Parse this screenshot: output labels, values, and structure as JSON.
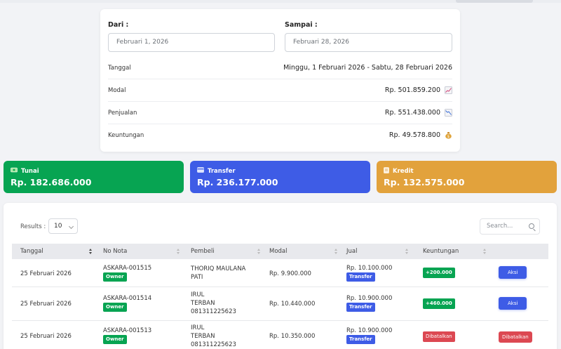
{
  "summary": {
    "from_label": "Dari :",
    "from_value": "Februari 1, 2026",
    "to_label": "Sampai :",
    "to_value": "Februari 28, 2026",
    "rows": [
      {
        "label": "Tanggal",
        "value": "Minggu, 1 Februari 2026 - Sabtu, 28 Februari 2026",
        "icon": ""
      },
      {
        "label": "Modal",
        "value": "Rp. 501.859.200",
        "icon": "chart-increasing-icon"
      },
      {
        "label": "Penjualan",
        "value": "Rp. 551.438.000",
        "icon": "chart-decreasing-icon"
      },
      {
        "label": "Keuntungan",
        "value": "Rp. 49.578.800",
        "icon": "money-bag-icon"
      }
    ]
  },
  "stats": {
    "tunai": {
      "label": "Tunai",
      "amount": "Rp. 182.686.000",
      "color": "#07a452",
      "icon": "cash-icon"
    },
    "transfer": {
      "label": "Transfer",
      "amount": "Rp. 236.177.000",
      "color": "#3e5ce6",
      "icon": "card-icon"
    },
    "kredit": {
      "label": "Kredit",
      "amount": "Rp. 132.575.000",
      "color": "#e2a23c",
      "icon": "ledger-icon"
    }
  },
  "table": {
    "results_label": "Results :",
    "page_size": "10",
    "search_placeholder": "Search...",
    "columns": [
      "Tanggal",
      "No Nota",
      "Pembeli",
      "Modal",
      "Jual",
      "Keuntungan"
    ],
    "rows": [
      {
        "tanggal": "25 Februari 2026",
        "nota": "ASKARA-001515",
        "nota_tag": "Owner",
        "pembeli": [
          "THORIQ MAULANA",
          "PATI"
        ],
        "modal": "Rp. 9.900.000",
        "jual": "Rp. 10.100.000",
        "jual_tag": "Transfer",
        "keuntungan": "+200.000",
        "status": "profit",
        "aksi": "Aksi"
      },
      {
        "tanggal": "25 Februari 2026",
        "nota": "ASKARA-001514",
        "nota_tag": "Owner",
        "pembeli": [
          "IRUL",
          "TERBAN",
          "081311225623"
        ],
        "modal": "Rp. 10.440.000",
        "jual": "Rp. 10.900.000",
        "jual_tag": "Transfer",
        "keuntungan": "+460.000",
        "status": "profit",
        "aksi": "Aksi"
      },
      {
        "tanggal": "25 Februari 2026",
        "nota": "ASKARA-001513",
        "nota_tag": "Owner",
        "pembeli": [
          "IRUL",
          "TERBAN",
          "081311225623"
        ],
        "modal": "Rp. 10.350.000",
        "jual": "Rp. 10.900.000",
        "jual_tag": "Transfer",
        "keuntungan": "Dibatalkan",
        "status": "cancelled",
        "aksi": "Dibatalkan"
      }
    ]
  },
  "colors": {
    "green": "#07a452",
    "blue": "#3e5ce6",
    "orange": "#e2a23c",
    "red": "#dc4852"
  }
}
